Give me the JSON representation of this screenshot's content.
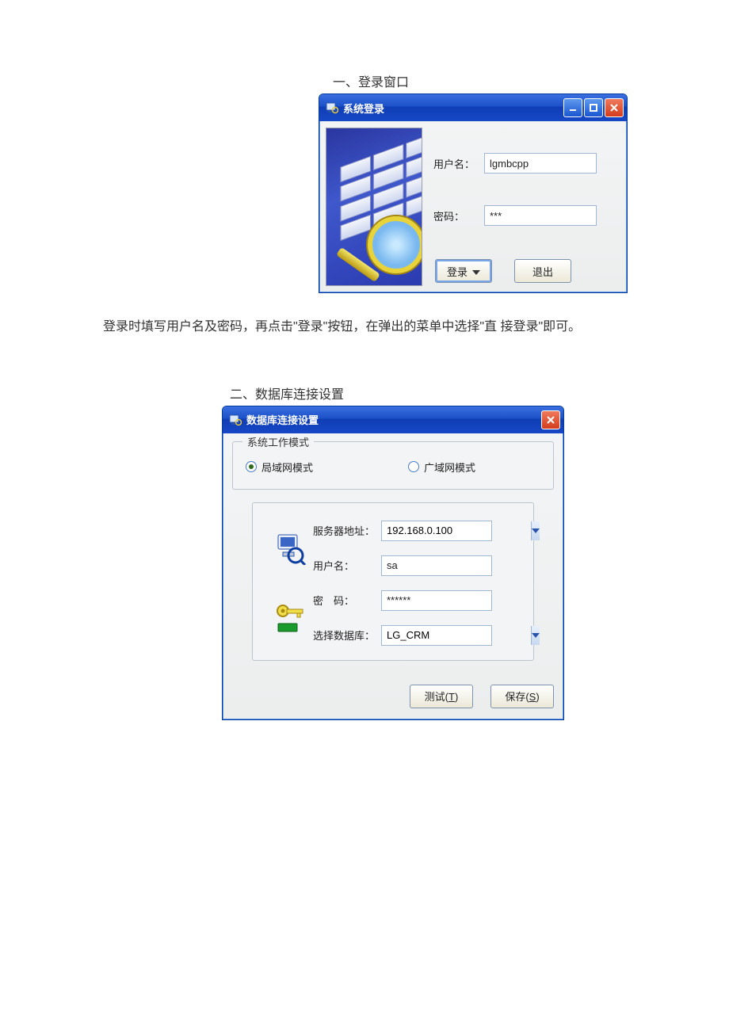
{
  "section1": {
    "heading": "一、登录窗口",
    "description": "登录时填写用户名及密码，再点击\"登录\"按钮，在弹出的菜单中选择\"直 接登录\"即可。"
  },
  "window1": {
    "title": "系统登录",
    "fields": {
      "username_label": "用户名：",
      "username_value": "lgmbcpp",
      "password_label": "密码：",
      "password_value": "***"
    },
    "buttons": {
      "login": "登录",
      "exit": "退出"
    }
  },
  "section2": {
    "heading": "二、数据库连接设置"
  },
  "window2": {
    "title": "数据库连接设置",
    "group_title": "系统工作模式",
    "radios": {
      "lan": "局域网模式",
      "wan": "广域网模式",
      "selected": "lan"
    },
    "fields": {
      "server_label": "服务器地址：",
      "server_value": "192.168.0.100",
      "username_label": "用户名：",
      "username_value": "sa",
      "password_label": "密　码：",
      "password_value": "******",
      "database_label": "选择数据库：",
      "database_value": "LG_CRM"
    },
    "buttons": {
      "test_prefix": "测试(",
      "test_key": "T",
      "test_suffix": ")",
      "save_prefix": "保存(",
      "save_key": "S",
      "save_suffix": ")"
    }
  }
}
